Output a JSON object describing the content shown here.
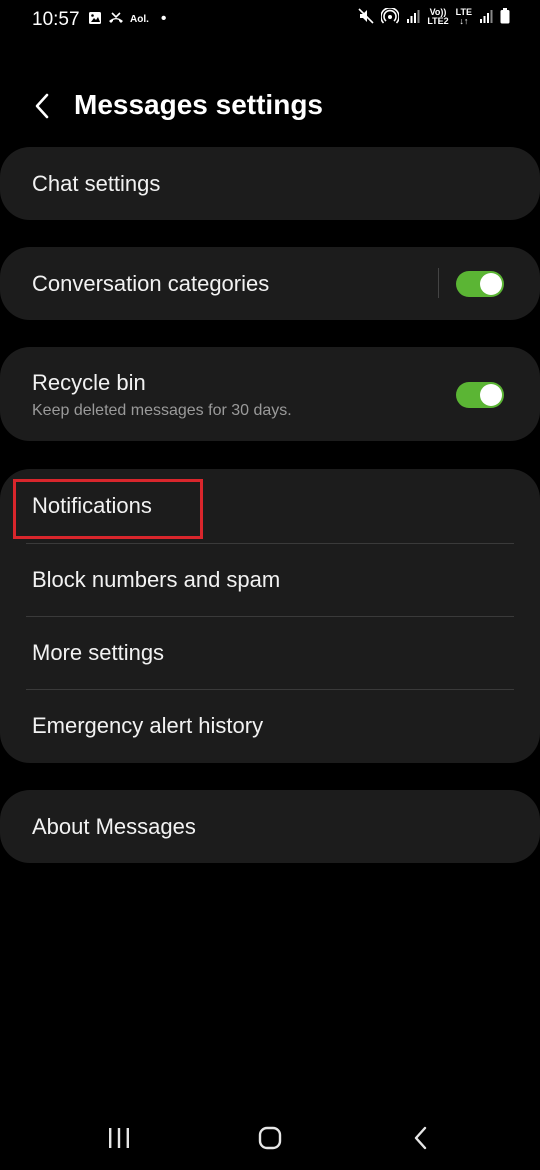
{
  "status_bar": {
    "time": "10:57",
    "left_icons": [
      "image-icon",
      "missed-call-icon"
    ],
    "carrier_text": "Aol.",
    "notification_dot": "•",
    "right_icons": [
      "mute-icon",
      "hotspot-icon",
      "signal-icon",
      "signal-icon",
      "battery-icon"
    ],
    "volte_line1": "Vo))",
    "volte_line2": "LTE2",
    "lte_label": "LTE"
  },
  "header": {
    "title": "Messages settings",
    "back_icon": "chevron-left-icon"
  },
  "settings": {
    "chat_settings": "Chat settings",
    "conversation_categories": "Conversation categories",
    "conversation_categories_on": true,
    "recycle_bin": "Recycle bin",
    "recycle_bin_sub": "Keep deleted messages for 30 days.",
    "recycle_bin_on": true,
    "notifications": "Notifications",
    "block_numbers": "Block numbers and spam",
    "more_settings": "More settings",
    "emergency_alert_history": "Emergency alert history",
    "about_messages": "About Messages"
  },
  "highlight_color": "#d9262c",
  "toggle_color": "#5bb534",
  "nav_bar": {
    "icons": [
      "recents-icon",
      "home-icon",
      "back-icon"
    ]
  }
}
